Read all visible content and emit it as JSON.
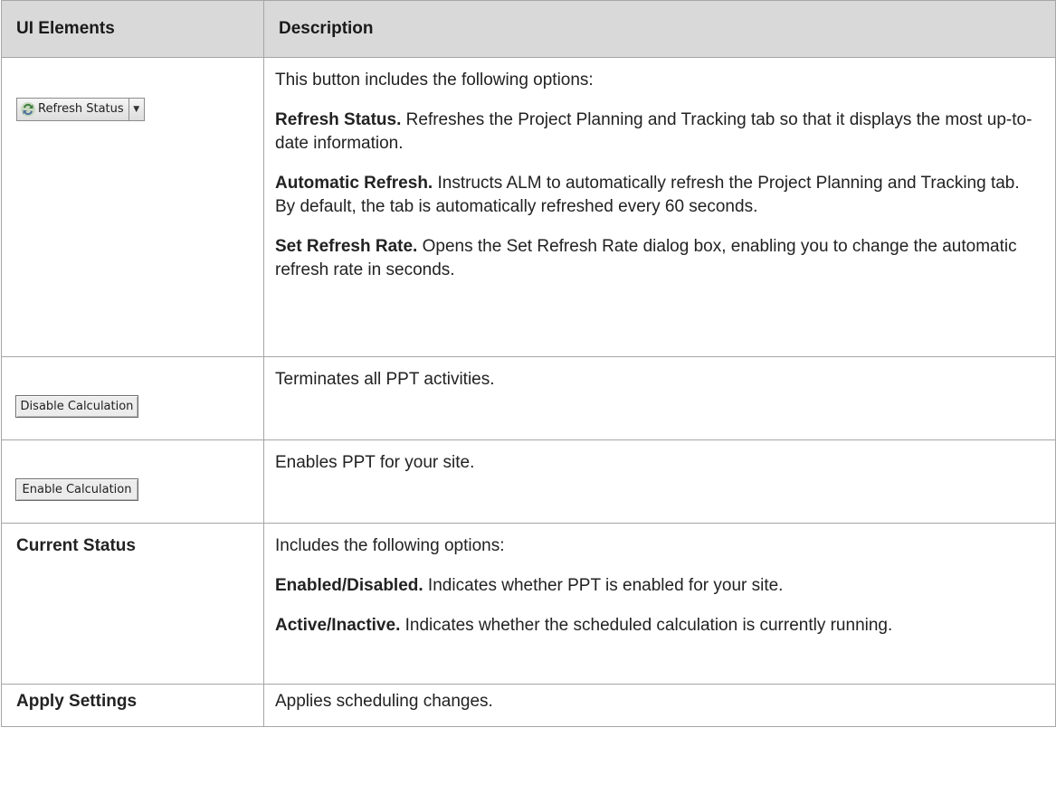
{
  "table": {
    "headers": {
      "ui_elements": "UI Elements",
      "description": "Description"
    },
    "rows": {
      "refresh": {
        "button": {
          "icon": "refresh-icon",
          "label": "Refresh Status"
        },
        "intro": "This button includes the following options:",
        "items": [
          {
            "term": "Refresh Status.",
            "text": " Refreshes the Project Planning and Tracking tab so that it displays the most up-to-date information."
          },
          {
            "term": "Automatic Refresh.",
            "text": " Instructs ALM to automatically refresh the Project Planning and Tracking tab. By default, the tab is automatically refreshed every 60 seconds."
          },
          {
            "term": "Set Refresh Rate.",
            "text": " Opens the Set Refresh Rate dialog box, enabling you to change the automatic refresh rate in seconds."
          }
        ]
      },
      "disable": {
        "button_label": "Disable Calculation",
        "description": "Terminates all PPT activities."
      },
      "enable": {
        "button_label": "Enable Calculation",
        "description": "Enables PPT for your site."
      },
      "current_status": {
        "element": "Current Status",
        "intro": "Includes the following options:",
        "items": [
          {
            "term": "Enabled/Disabled.",
            "text": " Indicates whether PPT is enabled for your site."
          },
          {
            "term": "Active/Inactive.",
            "text": " Indicates whether the scheduled calculation is currently running."
          }
        ]
      },
      "apply_settings": {
        "element": "Apply Settings",
        "description": "Applies scheduling changes."
      }
    }
  }
}
